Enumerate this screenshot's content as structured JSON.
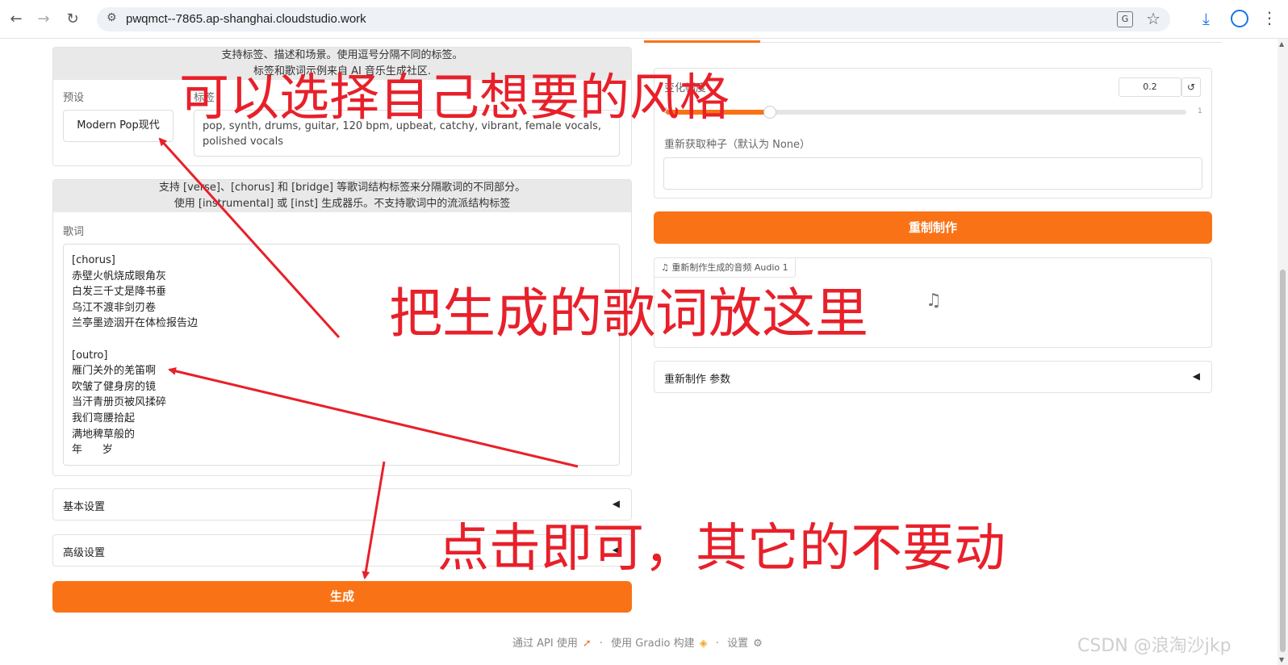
{
  "browser": {
    "url": "pwqmct--7865.ap-shanghai.cloudstudio.work",
    "translate_glyph": "G",
    "tune_glyph": "⚙"
  },
  "left": {
    "tags_info_line1": "支持标签、描述和场景。使用逗号分隔不同的标签。",
    "tags_info_line2": "标签和歌词示例来自 AI 音乐生成社区.",
    "preset_label": "预设",
    "preset_value": "Modern Pop现代",
    "tags_label": "标签",
    "tags_value": "pop, synth, drums, guitar, 120 bpm, upbeat, catchy, vibrant, female vocals, polished vocals",
    "lyrics_info_line1": "支持 [verse]、[chorus] 和 [bridge] 等歌词结构标签来分隔歌词的不同部分。",
    "lyrics_info_line2": "使用 [instrumental] 或 [inst] 生成器乐。不支持歌词中的流派结构标签",
    "lyrics_label": "歌词",
    "lyrics_lines": [
      "[chorus]",
      "赤壁火帆烧成眼角灰",
      "白发三千丈是降书垂",
      "乌江不渡非剑刃卷",
      "兰亭墨迹洇开在体检报告边",
      "",
      "[outro]",
      "雁门关外的羌笛啊",
      "吹皱了健身房的镜",
      "当汗青册页被风揉碎",
      "我们弯腰拾起",
      "满地稗草般的",
      "年      岁"
    ],
    "basic_settings": "基本设置",
    "advanced_settings": "高级设置",
    "accordion_arrow": "◀",
    "generate_button": "生成"
  },
  "right": {
    "slider_label": "变化幅度",
    "slider_value": "0.2",
    "slider_fraction": 0.2,
    "reset_glyph": "↺",
    "slider_min": "0",
    "slider_max": "1",
    "seed_label": "重新获取种子（默认为 None）",
    "seed_value": "",
    "remake_button": "重制制作",
    "audio_label": "重新制作生成的音频 Audio 1",
    "audio_tag_icon": "♫",
    "audio_icon": "♫",
    "remake_params": "重新制作 参数",
    "accordion_arrow": "◀"
  },
  "footer": {
    "api": "通过 API 使用",
    "dot1": "·",
    "gradio": "使用 Gradio 构建",
    "dot2": "·",
    "settings": "设置"
  },
  "annotations": {
    "style": "可以选择自己想要的风格",
    "lyrics": "把生成的歌词放这里",
    "click": "点击即可，其它的不要动"
  },
  "watermark": "CSDN @浪淘沙jkp",
  "colors": {
    "accent": "#f97316",
    "annotation": "#e8202a"
  }
}
